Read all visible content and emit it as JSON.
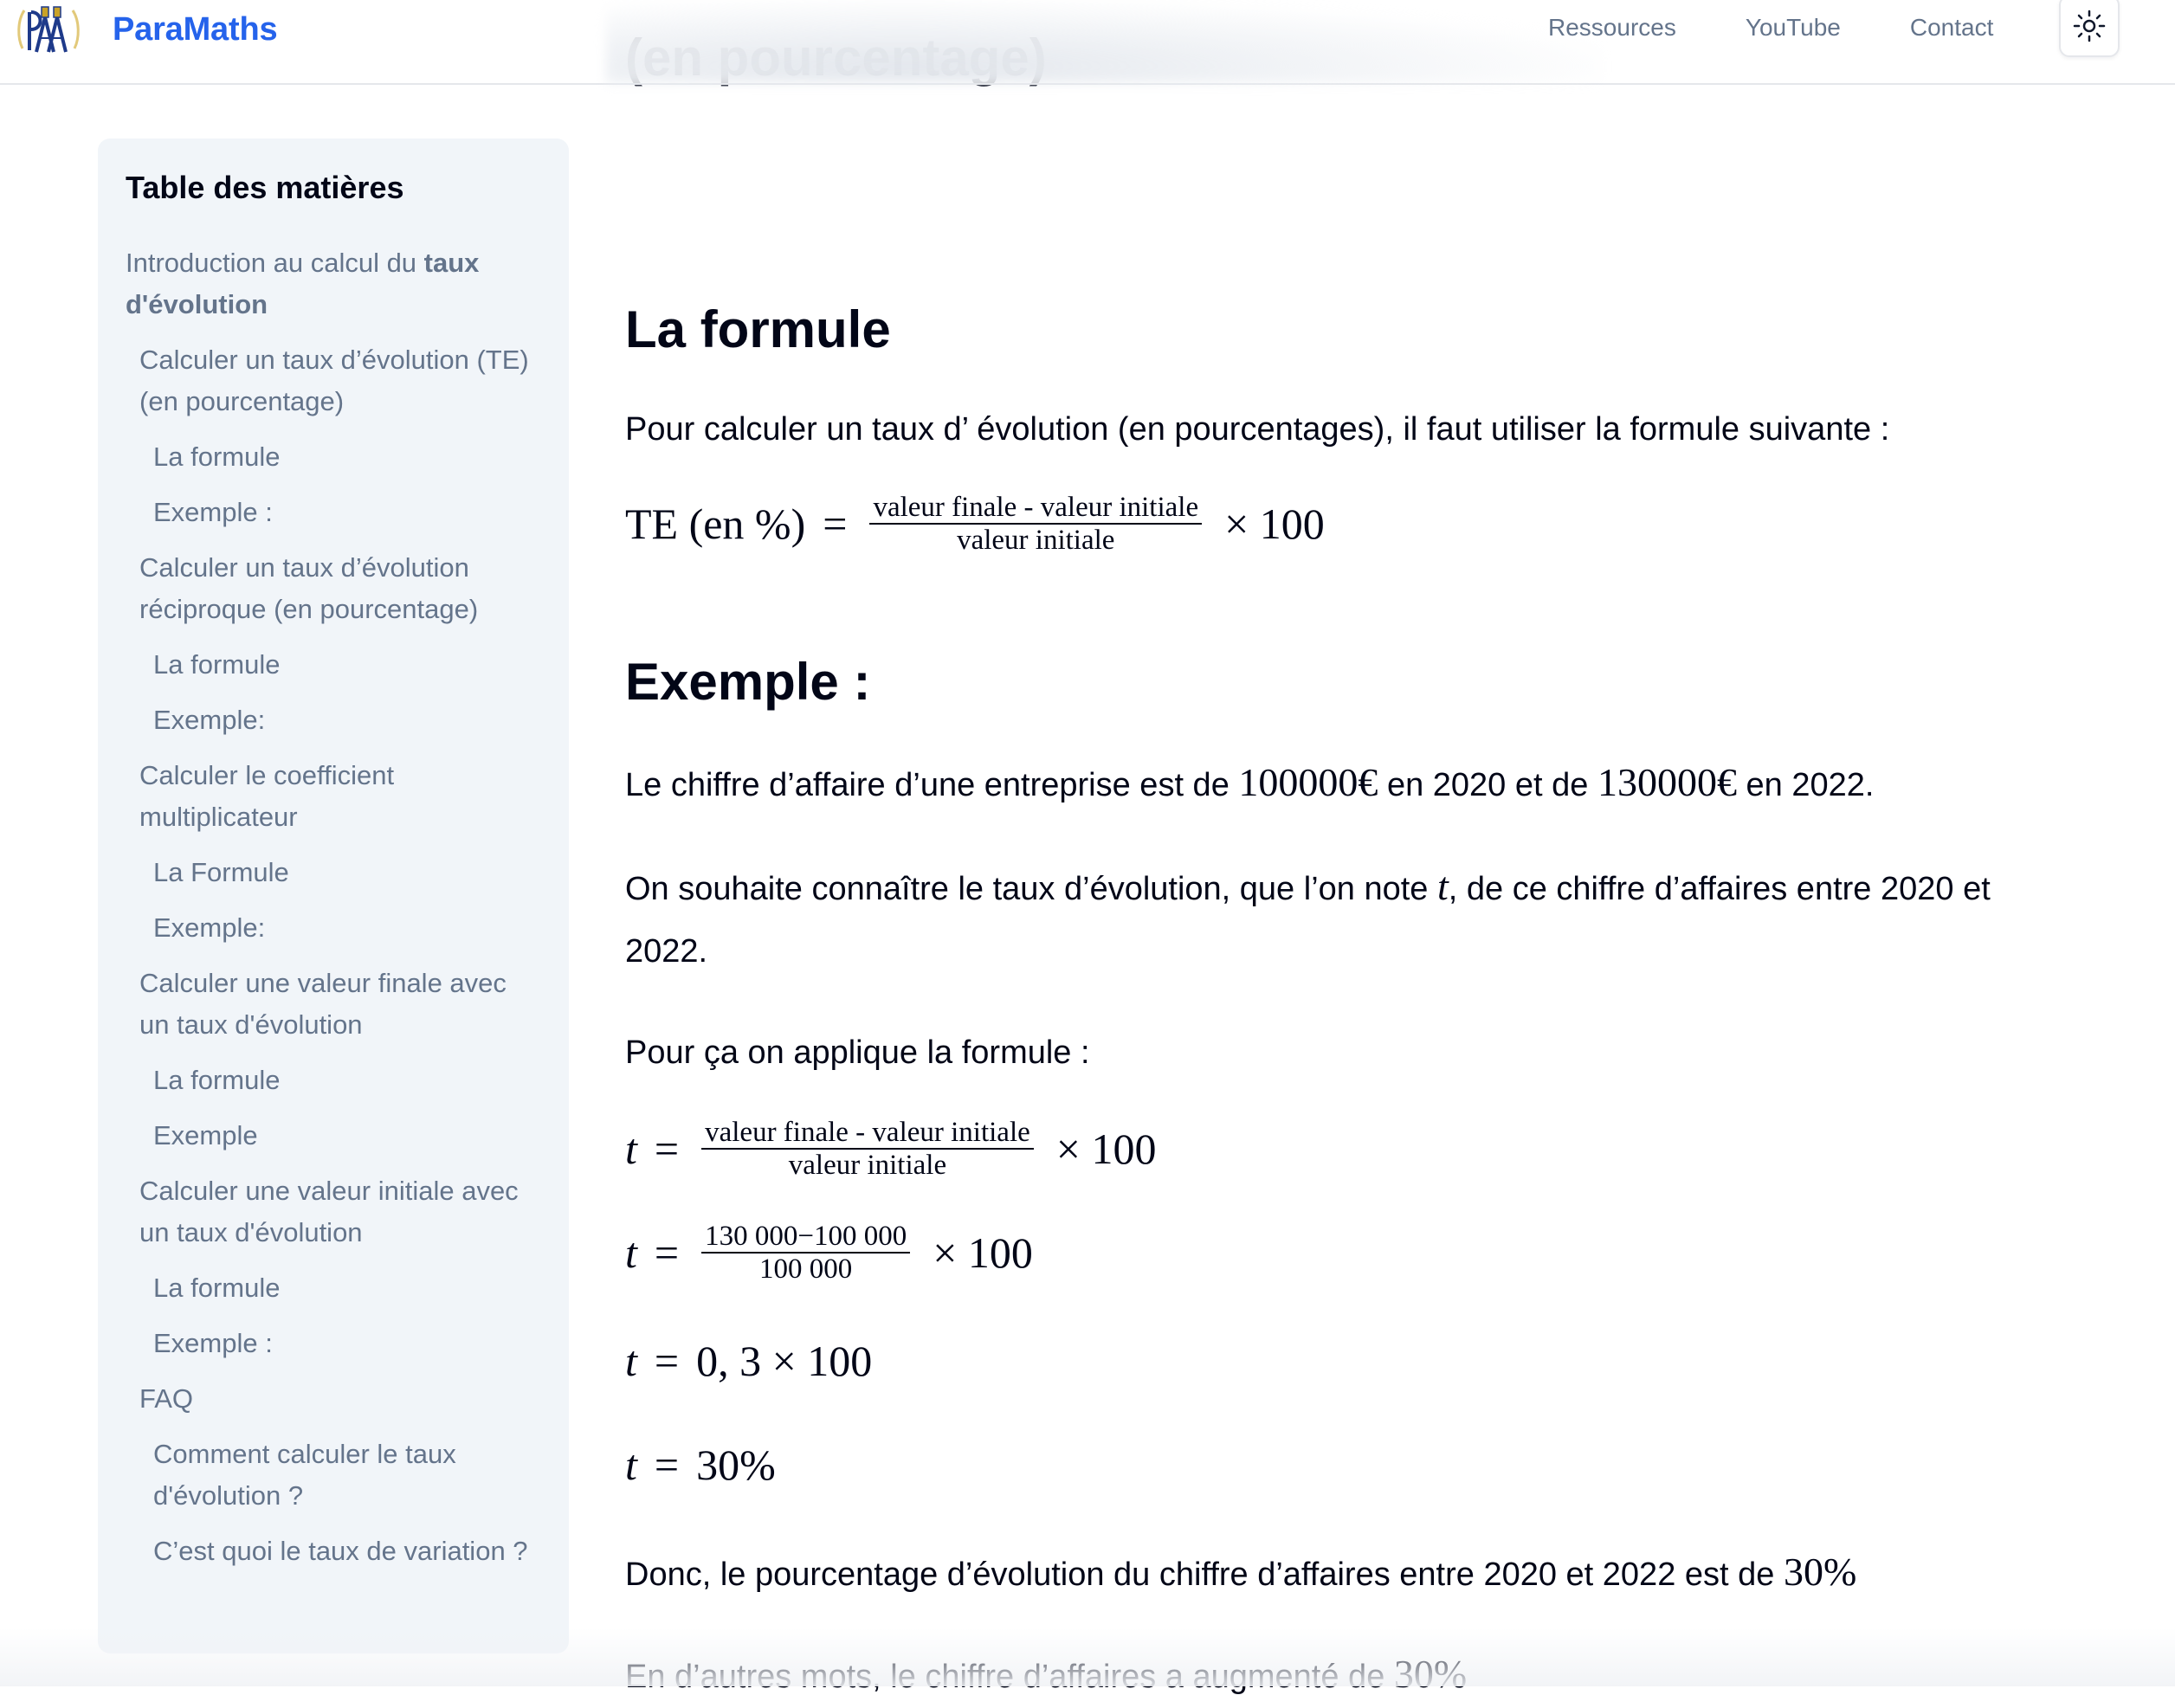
{
  "header": {
    "brand_name": "ParaMaths",
    "logo_icon": "compass-logo-icon",
    "nav": [
      "Ressources",
      "YouTube",
      "Contact"
    ],
    "theme_toggle_icon": "sun-icon",
    "brand_color": "#2563eb"
  },
  "previous_heading": "(en pourcentage)",
  "toc": {
    "title": "Table des matières",
    "items": [
      {
        "level": 1,
        "label": "Introduction au calcul du ",
        "bold": "taux d'évolution"
      },
      {
        "level": 2,
        "label": "Calculer un taux d’évolution (TE) (en pourcentage)"
      },
      {
        "level": 3,
        "label": "La formule"
      },
      {
        "level": 3,
        "label": "Exemple :"
      },
      {
        "level": 2,
        "label": "Calculer un taux d’évolution réciproque (en pourcentage)"
      },
      {
        "level": 3,
        "label": "La formule"
      },
      {
        "level": 3,
        "label": "Exemple:"
      },
      {
        "level": 2,
        "label": "Calculer le coefficient multiplicateur"
      },
      {
        "level": 3,
        "label": "La Formule"
      },
      {
        "level": 3,
        "label": "Exemple:"
      },
      {
        "level": 2,
        "label": "Calculer une valeur finale avec un taux d'évolution"
      },
      {
        "level": 3,
        "label": "La formule"
      },
      {
        "level": 3,
        "label": "Exemple"
      },
      {
        "level": 2,
        "label": "Calculer une valeur initiale avec un taux d'évolution"
      },
      {
        "level": 3,
        "label": "La formule"
      },
      {
        "level": 3,
        "label": "Exemple :"
      },
      {
        "level": 2,
        "label": "FAQ"
      },
      {
        "level": 3,
        "label": "Comment calculer le taux d'évolution ?"
      },
      {
        "level": 3,
        "label": "C’est quoi le taux de variation ?"
      }
    ]
  },
  "content": {
    "section_formula": {
      "heading": "La formule",
      "intro": "Pour calculer un taux d’ évolution (en pourcentages), il faut utiliser la formule suivante :",
      "formula": {
        "lhs": "TE (en %)",
        "equals": "=",
        "numerator": "valeur finale - valeur initiale",
        "denominator": "valeur initiale",
        "times": "× 100"
      }
    },
    "section_example": {
      "heading": "Exemple :",
      "p1_a": "Le chiffre d’affaire d’une entreprise est de ",
      "p1_v1": "100000€",
      "p1_b": " en 2020 et de ",
      "p1_v2": "130000€",
      "p1_c": " en 2022.",
      "p2_a": "On souhaite connaître le taux d’évolution, que l’on note ",
      "p2_var": "t",
      "p2_b": ", de ce chiffre d’affaires entre 2020 et 2022.",
      "p3": "Pour ça on applique la formule :",
      "eq1": {
        "lhs": "t",
        "equals": "=",
        "numerator": "valeur finale - valeur initiale",
        "denominator": "valeur initiale",
        "times": "× 100"
      },
      "eq2": {
        "lhs": "t",
        "equals": "=",
        "numerator": "130 000−100 000",
        "denominator": "100 000",
        "times": "× 100"
      },
      "eq3": {
        "lhs": "t",
        "equals": "=",
        "rhs": "0, 3 × 100"
      },
      "eq4": {
        "lhs": "t",
        "equals": "=",
        "rhs": "30%"
      },
      "p4_a": "Donc, le pourcentage d’évolution du chiffre d’affaires entre 2020 et 2022 est de ",
      "p4_v": "30%",
      "p5_a": "En d’autres mots, le chiffre d’affaires a augmenté de ",
      "p5_v": "30%"
    }
  }
}
